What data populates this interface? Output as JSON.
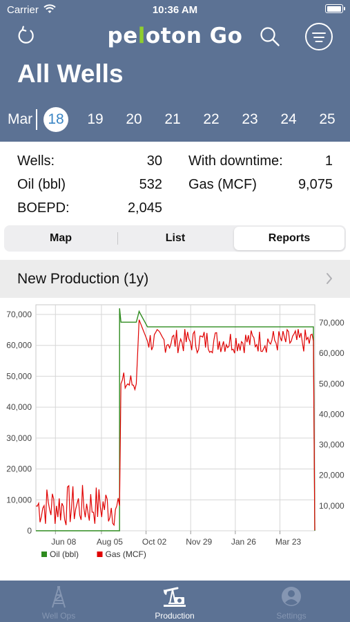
{
  "status": {
    "carrier": "Carrier",
    "time": "10:36 AM",
    "battery_level": 1.0
  },
  "header": {
    "logo_part1": "pe",
    "logo_bar": "l",
    "logo_part2": "oton Go",
    "title": "All Wells",
    "icons": [
      "refresh-icon",
      "search-icon",
      "menu-icon"
    ]
  },
  "date_strip": {
    "month": "Mar",
    "days": [
      "18",
      "19",
      "20",
      "21",
      "22",
      "23",
      "24",
      "25"
    ],
    "selected": "18",
    "selected_color": "#3b86c5"
  },
  "stats": {
    "wells_label": "Wells:",
    "wells_value": "30",
    "oil_label": "Oil (bbl)",
    "oil_value": "532",
    "boepd_label": "BOEPD:",
    "boepd_value": "2,045",
    "downtime_label": "With downtime:",
    "downtime_value": "1",
    "gas_label": "Gas (MCF)",
    "gas_value": "9,075"
  },
  "segments": {
    "map": "Map",
    "list": "List",
    "reports": "Reports",
    "active": "Reports"
  },
  "report": {
    "title": "New Production (1y)"
  },
  "chart_data": {
    "type": "line",
    "x_tick_labels": [
      "Jun 08",
      "Aug 05",
      "Oct 02",
      "Nov 29",
      "Jan 26",
      "Mar 23"
    ],
    "y_left_ticks": [
      "0",
      "10,000",
      "20,000",
      "30,000",
      "40,000",
      "50,000",
      "60,000",
      "70,000"
    ],
    "y_right_ticks": [
      "10,000",
      "20,000",
      "30,000",
      "40,000",
      "50,000",
      "60,000",
      "70,000"
    ],
    "ylim_left": [
      0,
      70000
    ],
    "ylim_right": [
      0,
      70000
    ],
    "grid": true,
    "legend_position": "bottom-left",
    "series": [
      {
        "name": "Oil (bbl)",
        "color": "#2e8b1e",
        "axis": "left",
        "points": [
          [
            0,
            0
          ],
          [
            0.3,
            0
          ],
          [
            0.3,
            72000
          ],
          [
            0.305,
            67500
          ],
          [
            0.36,
            67500
          ],
          [
            0.37,
            71000
          ],
          [
            0.4,
            66000
          ],
          [
            0.995,
            66000
          ],
          [
            1.0,
            0
          ]
        ]
      },
      {
        "name": "Gas (MCF)",
        "color": "#e00000",
        "axis": "right",
        "points": [
          [
            0,
            10000
          ],
          [
            0.29,
            10000
          ],
          [
            0.3,
            10000
          ],
          [
            0.305,
            50000
          ],
          [
            0.36,
            50000
          ],
          [
            0.37,
            71000
          ],
          [
            0.4,
            64000
          ],
          [
            0.995,
            64000
          ],
          [
            1.0,
            2000
          ]
        ]
      }
    ]
  },
  "tabs": [
    {
      "label": "Well Ops",
      "icon": "oil-derrick-icon",
      "active": false
    },
    {
      "label": "Production",
      "icon": "pumpjack-icon",
      "active": true
    },
    {
      "label": "Settings",
      "icon": "person-icon",
      "active": false
    }
  ]
}
